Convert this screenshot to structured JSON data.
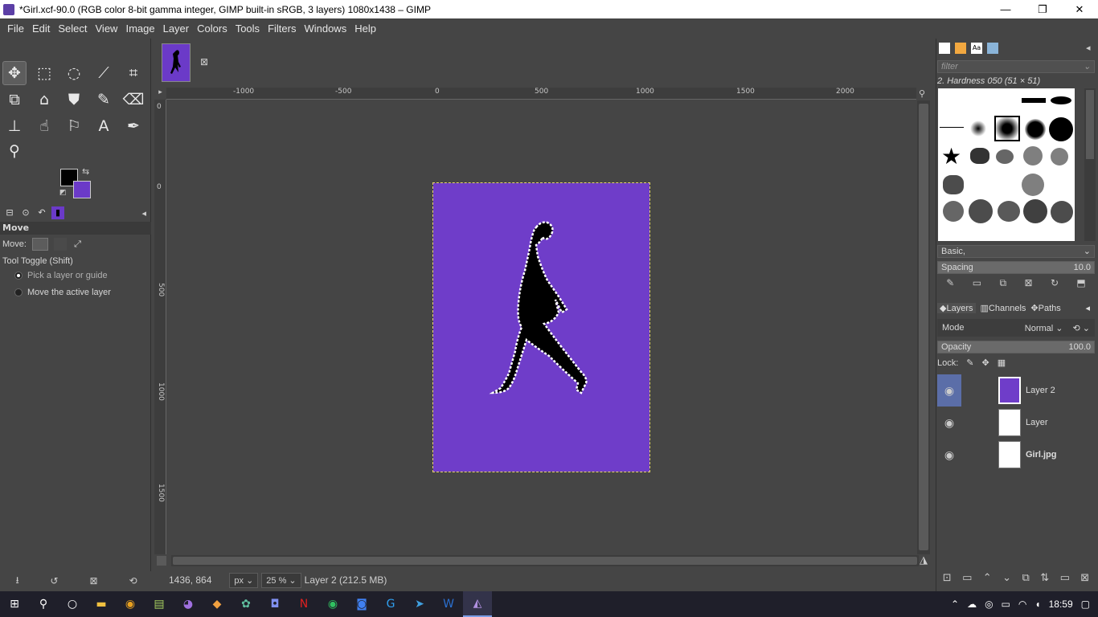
{
  "window": {
    "title": "*Girl.xcf-90.0 (RGB color 8-bit gamma integer, GIMP built-in sRGB, 3 layers) 1080x1438 – GIMP",
    "minimize": "—",
    "maximize": "❐",
    "close": "✕"
  },
  "menu": [
    "File",
    "Edit",
    "Select",
    "View",
    "Image",
    "Layer",
    "Colors",
    "Tools",
    "Filters",
    "Windows",
    "Help"
  ],
  "tool_options": {
    "title": "Move",
    "move_label": "Move:",
    "tool_toggle": "Tool Toggle  (Shift)",
    "option_1": "Pick a layer or guide",
    "option_2": "Move the active layer"
  },
  "colors": {
    "foreground": "#000000",
    "background": "#6b3ac8"
  },
  "ruler": {
    "h_labels": [
      "-1000",
      "-500",
      "0",
      "500",
      "1000",
      "1500",
      "2000"
    ],
    "v_labels": [
      "0",
      "0",
      "500",
      "1000",
      "1500"
    ]
  },
  "status": {
    "coords": "1436, 864",
    "unit": "px",
    "zoom": "25 %",
    "layer_info": "Layer 2 (212.5 MB)"
  },
  "brushes": {
    "filter_placeholder": "filter",
    "current": "2. Hardness 050 (51 × 51)",
    "preset": "Basic,",
    "spacing_label": "Spacing",
    "spacing_value": "10.0"
  },
  "layers_panel": {
    "tabs": [
      "Layers",
      "Channels",
      "Paths"
    ],
    "mode_label": "Mode",
    "mode_value": "Normal",
    "opacity_label": "Opacity",
    "opacity_value": "100.0",
    "lock_label": "Lock:",
    "layers": [
      {
        "name": "Layer 2",
        "selected": true
      },
      {
        "name": "Layer",
        "selected": false
      },
      {
        "name": "Girl.jpg",
        "selected": false
      }
    ]
  },
  "taskbar": {
    "time": "18:59"
  }
}
